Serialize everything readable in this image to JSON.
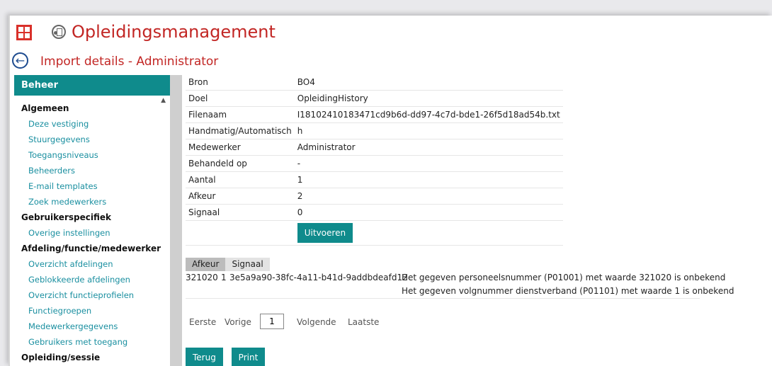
{
  "app": {
    "title": "Opleidingsmanagement"
  },
  "page": {
    "title": "Import details - Administrator"
  },
  "sidebar": {
    "header": "Beheer",
    "sections": [
      {
        "title": "Algemeen",
        "items": [
          "Deze vestiging",
          "Stuurgegevens",
          "Toegangsniveaus",
          "Beheerders",
          "E-mail templates",
          "Zoek medewerkers"
        ]
      },
      {
        "title": "Gebruikerspecifiek",
        "items": [
          "Overige instellingen"
        ]
      },
      {
        "title": "Afdeling/functie/medewerker",
        "items": [
          "Overzicht afdelingen",
          "Geblokkeerde afdelingen",
          "Overzicht functieprofielen",
          "Functiegroepen",
          "Medewerkergegevens",
          "Gebruikers met toegang"
        ]
      },
      {
        "title": "Opleiding/sessie",
        "items": []
      }
    ]
  },
  "details": [
    {
      "label": "Bron",
      "value": "BO4"
    },
    {
      "label": "Doel",
      "value": "OpleidingHistory"
    },
    {
      "label": "Filenaam",
      "value": "I18102410183471cd9b6d-dd97-4c7d-bde1-26f5d18ad54b.txt"
    },
    {
      "label": "Handmatig/Automatisch",
      "value": "h"
    },
    {
      "label": "Medewerker",
      "value": "Administrator"
    },
    {
      "label": "Behandeld op",
      "value": "-"
    },
    {
      "label": "Aantal",
      "value": "1"
    },
    {
      "label": "Afkeur",
      "value": "2"
    },
    {
      "label": "Signaal",
      "value": "0"
    }
  ],
  "actions": {
    "execute_label": "Uitvoeren",
    "back_label": "Terug",
    "print_label": "Print"
  },
  "result_tabs": [
    {
      "label": "Afkeur",
      "active": true
    },
    {
      "label": "Signaal",
      "active": false
    }
  ],
  "results": [
    {
      "code": "321020",
      "seq": "1",
      "guid": "3e5a9a90-38fc-4a11-b41d-9addbdeafd12",
      "message": "Het gegeven personeelsnummer (P01001) met waarde 321020 is onbekend"
    },
    {
      "code": "",
      "seq": "",
      "guid": "",
      "message": "Het gegeven volgnummer dienstverband (P01101) met waarde 1 is onbekend"
    }
  ],
  "pager": {
    "first": "Eerste",
    "prev": "Vorige",
    "page": "1",
    "next": "Volgende",
    "last": "Laatste"
  },
  "colors": {
    "brand_red": "#c22624",
    "accent_teal": "#0f8b8c",
    "link_teal": "#1a8fa0"
  }
}
